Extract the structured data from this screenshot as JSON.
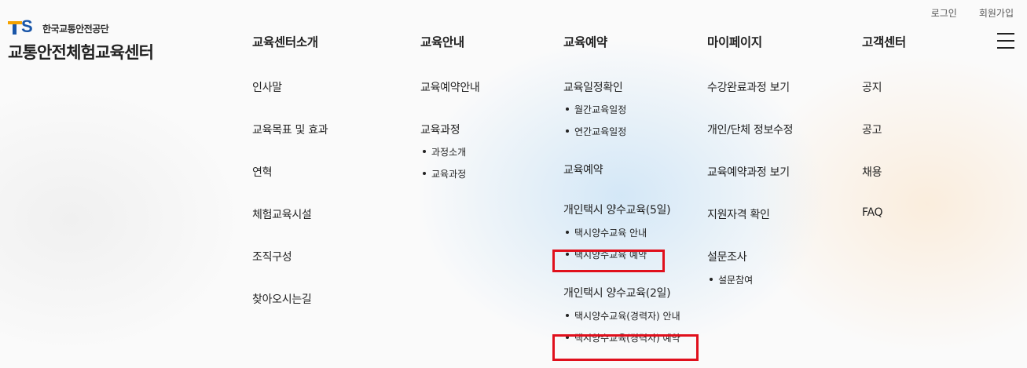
{
  "util_links": [
    "로그인",
    "회원가입"
  ],
  "logo": {
    "mark": "TS",
    "org": "한국교통안전공단",
    "title": "교통안전체험교육센터"
  },
  "menu_icon": "hamburger-menu-icon",
  "columns": [
    {
      "title": "교육센터소개",
      "items": [
        {
          "label": "인사말"
        },
        {
          "label": "교육목표 및 효과"
        },
        {
          "label": "연혁"
        },
        {
          "label": "체험교육시설"
        },
        {
          "label": "조직구성"
        },
        {
          "label": "찾아오시는길"
        }
      ]
    },
    {
      "title": "교육안내",
      "items": [
        {
          "label": "교육예약안내"
        },
        {
          "label": "교육과정",
          "sub": [
            "과정소개",
            "교육과정"
          ]
        }
      ]
    },
    {
      "title": "교육예약",
      "items": [
        {
          "label": "교육일정확인",
          "sub": [
            "월간교육일정",
            "연간교육일정"
          ]
        },
        {
          "label": "교육예약"
        },
        {
          "label": "개인택시 양수교육(5일)",
          "sub": [
            "택시양수교육 안내",
            "택시양수교육 예약"
          ]
        },
        {
          "label": "개인택시 양수교육(2일)",
          "sub": [
            "택시양수교육(경력자) 안내",
            "택시양수교육(경력자) 예약"
          ]
        }
      ]
    },
    {
      "title": "마이페이지",
      "items": [
        {
          "label": "수강완료과정 보기"
        },
        {
          "label": "개인/단체 정보수정"
        },
        {
          "label": "교육예약과정 보기"
        },
        {
          "label": "지원자격 확인"
        },
        {
          "label": "설문조사",
          "sub": [
            "설문참여"
          ]
        }
      ]
    },
    {
      "title": "고객센터",
      "items": [
        {
          "label": "공지"
        },
        {
          "label": "공고"
        },
        {
          "label": "채용"
        },
        {
          "label": "FAQ"
        }
      ]
    }
  ],
  "highlight_color": "#e0101c"
}
